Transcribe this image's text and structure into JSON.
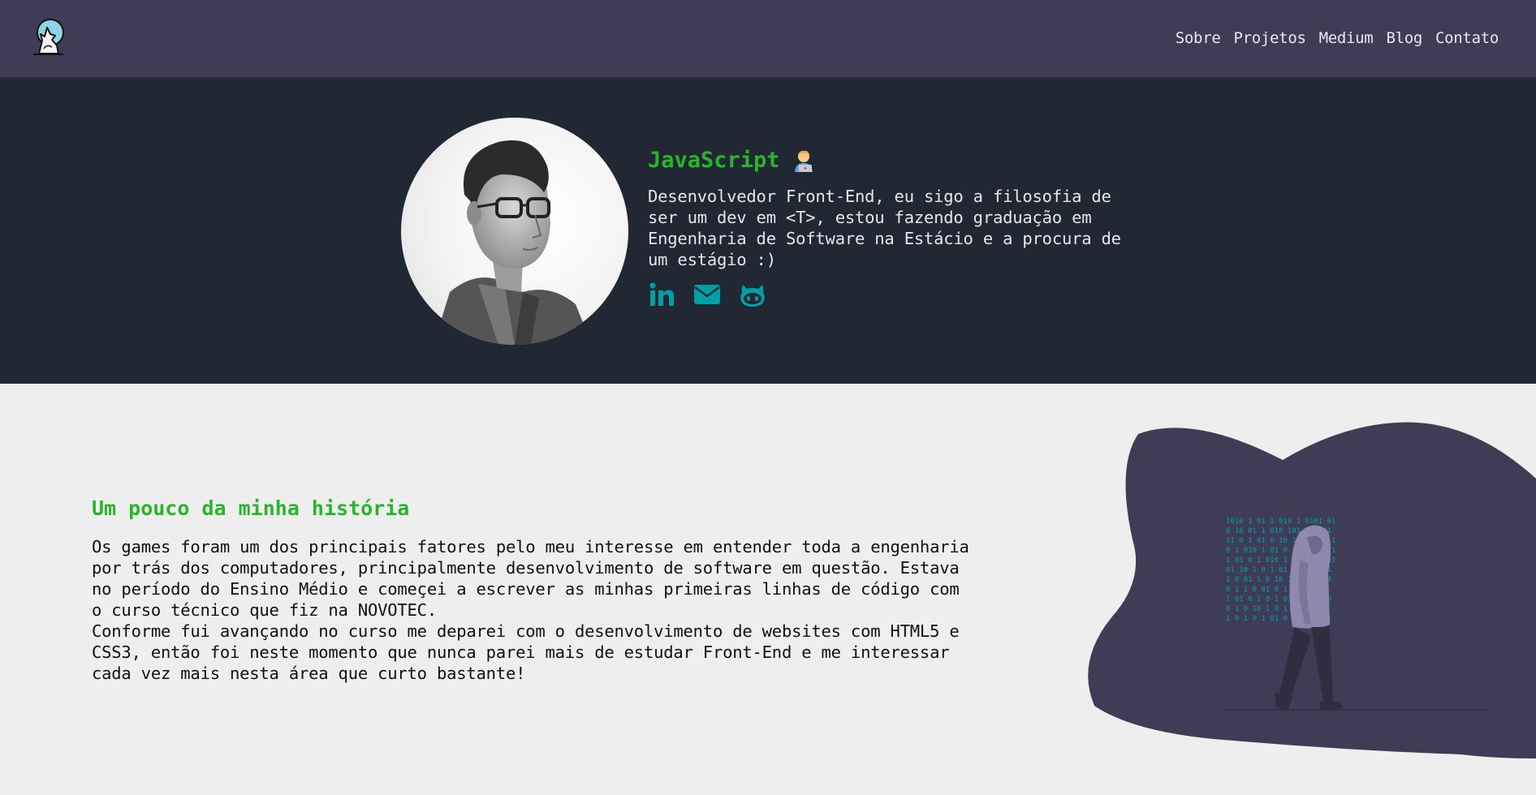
{
  "header": {
    "logo_icon": "wolf-howling-logo-icon",
    "nav": [
      {
        "label": "Sobre"
      },
      {
        "label": "Projetos"
      },
      {
        "label": "Medium"
      },
      {
        "label": "Blog"
      },
      {
        "label": "Contato"
      }
    ]
  },
  "hero": {
    "title": "JavaScript",
    "title_emoji_icon": "technologist-emoji-icon",
    "description": "Desenvolvedor Front-End, eu sigo a filosofia de ser um dev em <T>, estou fazendo graduação em Engenharia de Software na Estácio e a procura de um estágio :)",
    "socials": [
      {
        "icon": "linkedin-icon"
      },
      {
        "icon": "email-icon"
      },
      {
        "icon": "github-icon"
      }
    ]
  },
  "about": {
    "title": "Um pouco da minha história",
    "paragraph1": "Os games foram um dos principais fatores pelo meu interesse em entender toda a engenharia por trás dos computadores, principalmente desenvolvimento de software em questão. Estava no período do Ensino Médio e começei a escrever as minhas primeiras linhas de código com o curso técnico que fiz na NOVOTEC.",
    "paragraph2": "Conforme fui avançando no curso me deparei com o desenvolvimento de websites com HTML5 e CSS3, então foi neste momento que nunca parei mais de estudar Front-End e me interessar cada vez mais nesta área que curto bastante!"
  },
  "colors": {
    "navbar": "#3f3d56",
    "hero_bg": "#212733",
    "accent_green": "#29b52a",
    "social_teal": "#00a0a6",
    "page_bg": "#eeeeee"
  }
}
